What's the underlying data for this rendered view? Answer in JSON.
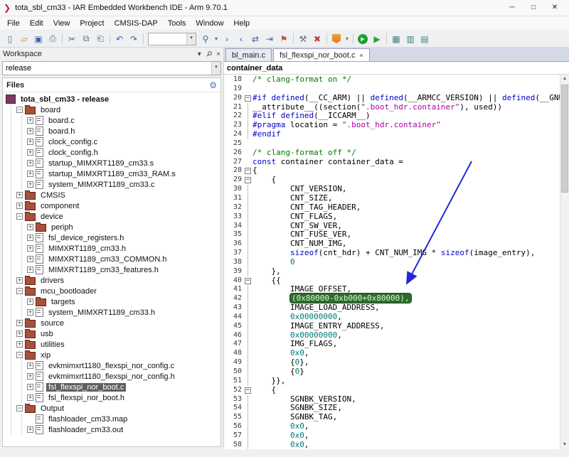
{
  "window": {
    "title": "tota_sbl_cm33 - IAR Embedded Workbench IDE - Arm 9.70.1"
  },
  "icons": {
    "app_logo": "❯",
    "minimize": "─",
    "maximize": "□",
    "window_close": "✕",
    "workspace_menu": "▾",
    "pin": "⚲",
    "panel_close": "×",
    "gear": "⚙",
    "combo_arrow": "▾",
    "tab_close": "×",
    "scroll_up": "▲",
    "scroll_down": "▼"
  },
  "menu": [
    "File",
    "Edit",
    "View",
    "Project",
    "CMSIS-DAP",
    "Tools",
    "Window",
    "Help"
  ],
  "toolbar": {
    "search_value": "",
    "items": [
      {
        "name": "new-document-icon",
        "glyph": "▯",
        "color": "#4a6fa5"
      },
      {
        "name": "open-file-icon",
        "glyph": "▱",
        "color": "#b8912f"
      },
      {
        "name": "save-icon",
        "glyph": "▣",
        "color": "#3f62a8"
      },
      {
        "name": "print-icon",
        "glyph": "⎙",
        "color": "#5a6b7a"
      },
      {
        "sep": true
      },
      {
        "name": "cut-icon",
        "glyph": "✂",
        "color": "#5a6b7a"
      },
      {
        "name": "copy-icon",
        "glyph": "⧉",
        "color": "#5a6b7a"
      },
      {
        "name": "paste-icon",
        "glyph": "⎗",
        "color": "#5a6b7a"
      },
      {
        "sep": true
      },
      {
        "name": "undo-icon",
        "glyph": "↶",
        "color": "#3f62a8"
      },
      {
        "name": "redo-icon",
        "glyph": "↷",
        "color": "#3f62a8"
      },
      {
        "sep": true
      },
      {
        "combo": true
      },
      {
        "name": "find-icon",
        "glyph": "⚲",
        "color": "#3f62a8"
      },
      {
        "name": "find-dropdown-icon",
        "glyph": "▾",
        "color": "#3f62a8",
        "narrow": true
      },
      {
        "name": "find-next-icon",
        "glyph": "›",
        "color": "#3f62a8"
      },
      {
        "name": "find-previous-icon",
        "glyph": "‹",
        "color": "#3f62a8"
      },
      {
        "name": "replace-icon",
        "glyph": "⇄",
        "color": "#3f62a8"
      },
      {
        "name": "goto-icon",
        "glyph": "⇥",
        "color": "#3f62a8"
      },
      {
        "name": "bookmark-icon",
        "glyph": "⚑",
        "color": "#b85c2f"
      },
      {
        "sep": true
      },
      {
        "name": "make-icon",
        "glyph": "⚒",
        "color": "#5a6b7a"
      },
      {
        "name": "stop-build-icon",
        "glyph": "✖",
        "color": "#c43c3c"
      },
      {
        "sep": true
      },
      {
        "name": "download-icon",
        "style": "shield"
      },
      {
        "name": "download-dropdown-icon",
        "glyph": "▾",
        "color": "#b85c1f",
        "narrow": true
      },
      {
        "sep": true
      },
      {
        "name": "download-and-debug-icon",
        "style": "circle-play",
        "glyph": "▶"
      },
      {
        "name": "debug-without-downloading-icon",
        "glyph": "▶",
        "color": "#2e9e3e"
      },
      {
        "sep": true
      },
      {
        "name": "cspy-windows-icon",
        "glyph": "▦",
        "color": "#3f7f7f"
      },
      {
        "name": "registers-window-icon",
        "glyph": "▥",
        "color": "#3f7f7f"
      },
      {
        "name": "memory-window-icon",
        "glyph": "▤",
        "color": "#3f7f7f"
      }
    ]
  },
  "workspace": {
    "title": "Workspace",
    "config_selector": "release",
    "files_header": "Files",
    "tree": [
      {
        "label": "tota_sbl_cm33 - release",
        "level": 0,
        "icon": "project",
        "expander": "",
        "bold": true
      },
      {
        "label": "board",
        "level": 1,
        "icon": "folder",
        "expander": "minus"
      },
      {
        "label": "board.c",
        "level": 2,
        "icon": "file",
        "expander": "plus"
      },
      {
        "label": "board.h",
        "level": 2,
        "icon": "file",
        "expander": "plus"
      },
      {
        "label": "clock_config.c",
        "level": 2,
        "icon": "file",
        "expander": "plus"
      },
      {
        "label": "clock_config.h",
        "level": 2,
        "icon": "file",
        "expander": "plus"
      },
      {
        "label": "startup_MIMXRT1189_cm33.s",
        "level": 2,
        "icon": "file",
        "expander": "plus"
      },
      {
        "label": "startup_MIMXRT1189_cm33_RAM.s",
        "level": 2,
        "icon": "file",
        "expander": "plus"
      },
      {
        "label": "system_MIMXRT1189_cm33.c",
        "level": 2,
        "icon": "file",
        "expander": "plus"
      },
      {
        "label": "CMSIS",
        "level": 1,
        "icon": "folder",
        "expander": "plus"
      },
      {
        "label": "component",
        "level": 1,
        "icon": "folder",
        "expander": "plus"
      },
      {
        "label": "device",
        "level": 1,
        "icon": "folder",
        "expander": "minus"
      },
      {
        "label": "periph",
        "level": 2,
        "icon": "folder",
        "expander": "plus"
      },
      {
        "label": "fsl_device_registers.h",
        "level": 2,
        "icon": "file",
        "expander": "plus"
      },
      {
        "label": "MIMXRT1189_cm33.h",
        "level": 2,
        "icon": "file",
        "expander": "plus"
      },
      {
        "label": "MIMXRT1189_cm33_COMMON.h",
        "level": 2,
        "icon": "file",
        "expander": "plus"
      },
      {
        "label": "MIMXRT1189_cm33_features.h",
        "level": 2,
        "icon": "file",
        "expander": "plus"
      },
      {
        "label": "drivers",
        "level": 1,
        "icon": "folder",
        "expander": "plus"
      },
      {
        "label": "mcu_bootloader",
        "level": 1,
        "icon": "folder",
        "expander": "minus"
      },
      {
        "label": "targets",
        "level": 2,
        "icon": "folder",
        "expander": "plus"
      },
      {
        "label": "system_MIMXRT1189_cm33.h",
        "level": 2,
        "icon": "file",
        "expander": "plus"
      },
      {
        "label": "source",
        "level": 1,
        "icon": "folder",
        "expander": "plus"
      },
      {
        "label": "usb",
        "level": 1,
        "icon": "folder",
        "expander": "plus"
      },
      {
        "label": "utilities",
        "level": 1,
        "icon": "folder",
        "expander": "plus"
      },
      {
        "label": "xip",
        "level": 1,
        "icon": "folder",
        "expander": "minus"
      },
      {
        "label": "evkmimxrt1180_flexspi_nor_config.c",
        "level": 2,
        "icon": "file",
        "expander": "plus"
      },
      {
        "label": "evkmimxrt1180_flexspi_nor_config.h",
        "level": 2,
        "icon": "file",
        "expander": "plus"
      },
      {
        "label": "fsl_flexspi_nor_boot.c",
        "level": 2,
        "icon": "file",
        "expander": "plus",
        "selected": true
      },
      {
        "label": "fsl_flexspi_nor_boot.h",
        "level": 2,
        "icon": "file",
        "expander": "plus"
      },
      {
        "label": "Output",
        "level": 1,
        "icon": "folder",
        "expander": "minus"
      },
      {
        "label": "flashloader_cm33.map",
        "level": 2,
        "icon": "file",
        "expander": ""
      },
      {
        "label": "flashloader_cm33.out",
        "level": 2,
        "icon": "file",
        "expander": "plus"
      }
    ]
  },
  "editor": {
    "tabs": [
      {
        "label": "bl_main.c",
        "active": false
      },
      {
        "label": "fsl_flexspi_nor_boot.c",
        "active": true,
        "closable": true
      }
    ],
    "context_bar": "container_data",
    "lines": [
      {
        "n": 18,
        "f": "",
        "s": [
          [
            "cm",
            "/* clang-format on */"
          ]
        ]
      },
      {
        "n": 19,
        "f": "",
        "s": []
      },
      {
        "n": 20,
        "f": "s",
        "s": [
          [
            "pp",
            "#if defined"
          ],
          [
            "pl",
            "(__CC_ARM) || "
          ],
          [
            "pp",
            "defined"
          ],
          [
            "pl",
            "(__ARMCC_VERSION) || "
          ],
          [
            "pp",
            "defined"
          ],
          [
            "pl",
            "(__GNUC__)"
          ]
        ]
      },
      {
        "n": 21,
        "f": "l",
        "s": [
          [
            "pl",
            "__attribute__((section("
          ],
          [
            "st",
            "\".boot_hdr.container\""
          ],
          [
            "pl",
            "), used))"
          ]
        ]
      },
      {
        "n": 22,
        "f": "l",
        "s": [
          [
            "pp",
            "#elif defined"
          ],
          [
            "pl",
            "(__ICCARM__)"
          ]
        ]
      },
      {
        "n": 23,
        "f": "l",
        "s": [
          [
            "pp",
            "#pragma"
          ],
          [
            "pl",
            " location = "
          ],
          [
            "st",
            "\".boot_hdr.container\""
          ]
        ]
      },
      {
        "n": 24,
        "f": "l",
        "s": [
          [
            "pp",
            "#endif"
          ]
        ]
      },
      {
        "n": 25,
        "f": "",
        "s": []
      },
      {
        "n": 26,
        "f": "",
        "s": [
          [
            "cm",
            "/* clang-format off */"
          ]
        ]
      },
      {
        "n": 27,
        "f": "",
        "s": [
          [
            "pp",
            "const"
          ],
          [
            "pl",
            " container container_data ="
          ]
        ]
      },
      {
        "n": 28,
        "f": "s",
        "s": [
          [
            "pl",
            "{"
          ]
        ]
      },
      {
        "n": 29,
        "f": "s",
        "s": [
          [
            "pl",
            "    {"
          ]
        ]
      },
      {
        "n": 30,
        "f": "l",
        "s": [
          [
            "pl",
            "        CNT_VERSION,"
          ]
        ]
      },
      {
        "n": 31,
        "f": "l",
        "s": [
          [
            "pl",
            "        CNT_SIZE,"
          ]
        ]
      },
      {
        "n": 32,
        "f": "l",
        "s": [
          [
            "pl",
            "        CNT_TAG_HEADER,"
          ]
        ]
      },
      {
        "n": 33,
        "f": "l",
        "s": [
          [
            "pl",
            "        CNT_FLAGS,"
          ]
        ]
      },
      {
        "n": 34,
        "f": "l",
        "s": [
          [
            "pl",
            "        CNT_SW_VER,"
          ]
        ]
      },
      {
        "n": 35,
        "f": "l",
        "s": [
          [
            "pl",
            "        CNT_FUSE_VER,"
          ]
        ]
      },
      {
        "n": 36,
        "f": "l",
        "s": [
          [
            "pl",
            "        CNT_NUM_IMG,"
          ]
        ]
      },
      {
        "n": 37,
        "f": "l",
        "s": [
          [
            "pl",
            "        "
          ],
          [
            "pp",
            "sizeof"
          ],
          [
            "pl",
            "(cnt_hdr) + CNT_NUM_IMG * "
          ],
          [
            "pp",
            "sizeof"
          ],
          [
            "pl",
            "(image_entry),"
          ]
        ]
      },
      {
        "n": 38,
        "f": "l",
        "s": [
          [
            "pl",
            "        "
          ],
          [
            "nm",
            "0"
          ]
        ]
      },
      {
        "n": 39,
        "f": "l",
        "s": [
          [
            "pl",
            "    },"
          ]
        ]
      },
      {
        "n": 40,
        "f": "s",
        "s": [
          [
            "pl",
            "    {{"
          ]
        ]
      },
      {
        "n": 41,
        "f": "l",
        "s": [
          [
            "pl",
            "        IMAGE_OFFSET,"
          ]
        ]
      },
      {
        "n": 42,
        "f": "l",
        "s": [
          [
            "pl",
            "        "
          ],
          [
            "hl",
            "(0x80000-0xb000+0x80000),"
          ]
        ]
      },
      {
        "n": 43,
        "f": "l",
        "s": [
          [
            "pl",
            "        IMAGE_LOAD_ADDRESS,"
          ]
        ]
      },
      {
        "n": 44,
        "f": "l",
        "s": [
          [
            "pl",
            "        "
          ],
          [
            "nm",
            "0x00000000"
          ],
          [
            "pl",
            ","
          ]
        ]
      },
      {
        "n": 45,
        "f": "l",
        "s": [
          [
            "pl",
            "        IMAGE_ENTRY_ADDRESS,"
          ]
        ]
      },
      {
        "n": 46,
        "f": "l",
        "s": [
          [
            "pl",
            "        "
          ],
          [
            "nm",
            "0x00000000"
          ],
          [
            "pl",
            ","
          ]
        ]
      },
      {
        "n": 47,
        "f": "l",
        "s": [
          [
            "pl",
            "        IMG_FLAGS,"
          ]
        ]
      },
      {
        "n": 48,
        "f": "l",
        "s": [
          [
            "pl",
            "        "
          ],
          [
            "nm",
            "0x0"
          ],
          [
            "pl",
            ","
          ]
        ]
      },
      {
        "n": 49,
        "f": "l",
        "s": [
          [
            "pl",
            "        {"
          ],
          [
            "nm",
            "0"
          ],
          [
            "pl",
            "},"
          ]
        ]
      },
      {
        "n": 50,
        "f": "l",
        "s": [
          [
            "pl",
            "        {"
          ],
          [
            "nm",
            "0"
          ],
          [
            "pl",
            "}"
          ]
        ]
      },
      {
        "n": 51,
        "f": "l",
        "s": [
          [
            "pl",
            "    }},"
          ]
        ]
      },
      {
        "n": 52,
        "f": "s",
        "s": [
          [
            "pl",
            "    {"
          ]
        ]
      },
      {
        "n": 53,
        "f": "l",
        "s": [
          [
            "pl",
            "        SGNBK_VERSION,"
          ]
        ]
      },
      {
        "n": 54,
        "f": "l",
        "s": [
          [
            "pl",
            "        SGNBK_SIZE,"
          ]
        ]
      },
      {
        "n": 55,
        "f": "l",
        "s": [
          [
            "pl",
            "        SGNBK_TAG,"
          ]
        ]
      },
      {
        "n": 56,
        "f": "l",
        "s": [
          [
            "pl",
            "        "
          ],
          [
            "nm",
            "0x0"
          ],
          [
            "pl",
            ","
          ]
        ]
      },
      {
        "n": 57,
        "f": "l",
        "s": [
          [
            "pl",
            "        "
          ],
          [
            "nm",
            "0x0"
          ],
          [
            "pl",
            ","
          ]
        ]
      },
      {
        "n": 58,
        "f": "l",
        "s": [
          [
            "pl",
            "        "
          ],
          [
            "nm",
            "0x0"
          ],
          [
            "pl",
            ","
          ]
        ]
      }
    ]
  },
  "annotation": {
    "arrow_color": "#2626d4",
    "highlight_bg": "#2e6b30",
    "highlight_text": "#e4f4d4"
  }
}
